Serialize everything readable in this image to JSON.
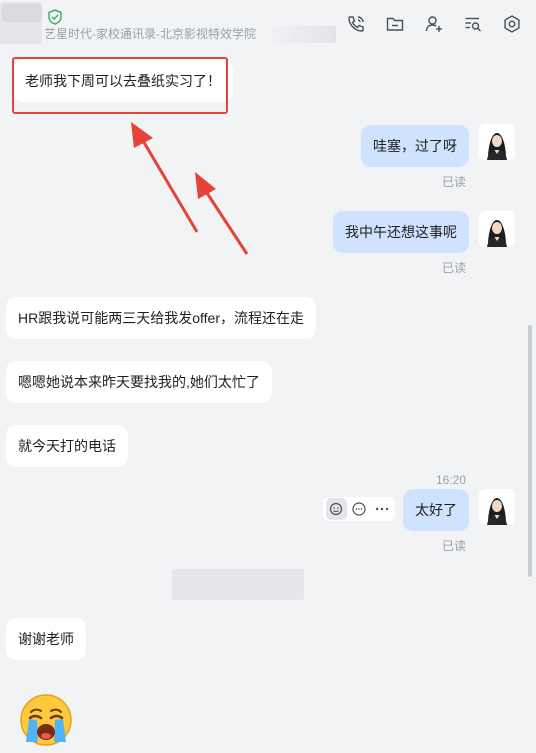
{
  "header": {
    "subtitle": "艺星时代-家校通讯录-北京影视特效学院",
    "tools": [
      "phone-icon",
      "folder-icon",
      "add-user-icon",
      "search-list-icon",
      "settings-icon"
    ]
  },
  "messages": {
    "m1": "老师我下周可以去叠纸实习了！",
    "m2": "哇塞，过了呀",
    "m3": "我中午还想这事呢",
    "m4": "HR跟我说可能两三天给我发offer，流程还在走",
    "m5": "嗯嗯她说本来昨天要找我的,她们太忙了",
    "m6": "就今天打的电话",
    "m7": "太好了",
    "m8": "谢谢老师"
  },
  "status": {
    "read1": "已读",
    "read2": "已读",
    "read3": "已读",
    "time1": "16:20"
  },
  "colors": {
    "annotation": "#e5433a",
    "outgoing_bubble": "#cfe2ff",
    "incoming_bubble": "#ffffff",
    "background": "#f2f3f5"
  }
}
